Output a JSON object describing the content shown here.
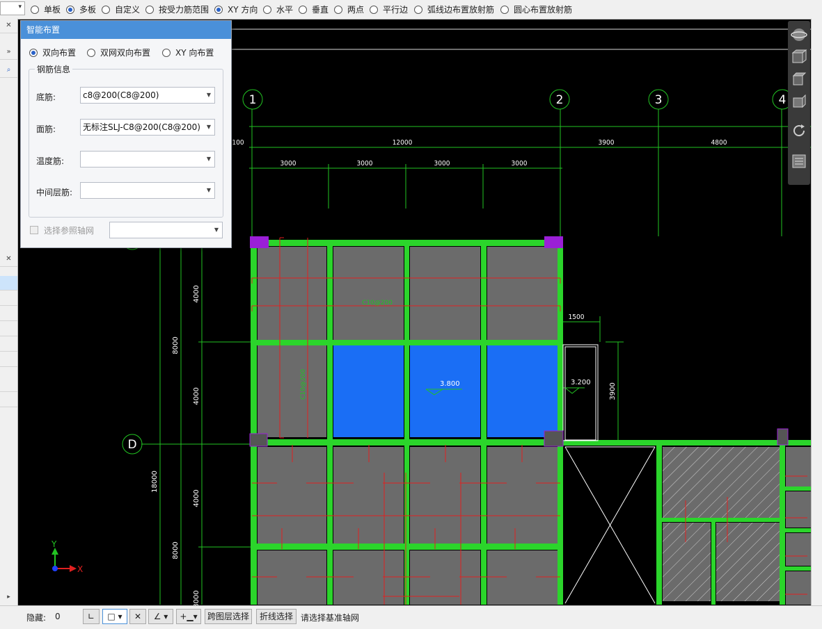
{
  "toolbar": {
    "options": [
      {
        "label": "单板",
        "selected": false
      },
      {
        "label": "多板",
        "selected": true
      },
      {
        "label": "自定义",
        "selected": false
      },
      {
        "label": "按受力筋范围",
        "selected": false
      },
      {
        "label": "XY 方向",
        "selected": true
      },
      {
        "label": "水平",
        "selected": false
      },
      {
        "label": "垂直",
        "selected": false
      },
      {
        "label": "两点",
        "selected": false
      },
      {
        "label": "平行边",
        "selected": false
      },
      {
        "label": "弧线边布置放射筋",
        "selected": false
      },
      {
        "label": "圆心布置放射筋",
        "selected": false
      }
    ]
  },
  "panel": {
    "title": "智能布置",
    "modes": [
      {
        "label": "双向布置",
        "selected": true
      },
      {
        "label": "双网双向布置",
        "selected": false
      },
      {
        "label": "XY 向布置",
        "selected": false
      }
    ],
    "group_title": "钢筋信息",
    "fields": {
      "bottom": {
        "label": "底筋:",
        "value": "c8@200(C8@200)"
      },
      "top": {
        "label": "面筋:",
        "value": "无标注SLJ-C8@200(C8@200)"
      },
      "temp": {
        "label": "温度筋:",
        "value": ""
      },
      "mid": {
        "label": "中间层筋:",
        "value": ""
      }
    },
    "ref_axis_label": "选择参照轴网"
  },
  "cad": {
    "axis_labels": [
      "1",
      "2",
      "3",
      "4",
      "D"
    ],
    "dims": {
      "d100": "100",
      "d12000": "12000",
      "d3900": "3900",
      "d4800": "4800",
      "d3000": "3000",
      "d1500": "1500",
      "d8000": "8000",
      "d4000": "4000",
      "d18000": "18000",
      "d3900v": "3900"
    },
    "elev_a": "3.800",
    "elev_b": "3.200",
    "rebar_a": "C10@200",
    "rebar_b": "C10@200"
  },
  "status": {
    "hidden_label": "隐藏:",
    "hidden_count": "0",
    "btn_cross_layer": "跨图层选择",
    "btn_polyline": "折线选择",
    "prompt": "请选择基准轴网"
  },
  "colors": {
    "beam": "#2bd52b",
    "slab": "#6b6b6b",
    "selected_slab": "#1a6ef5",
    "rebar": "#e02020",
    "column": "#9a1fd6",
    "axis": "#22c322",
    "panel_title": "#4a90d9"
  }
}
